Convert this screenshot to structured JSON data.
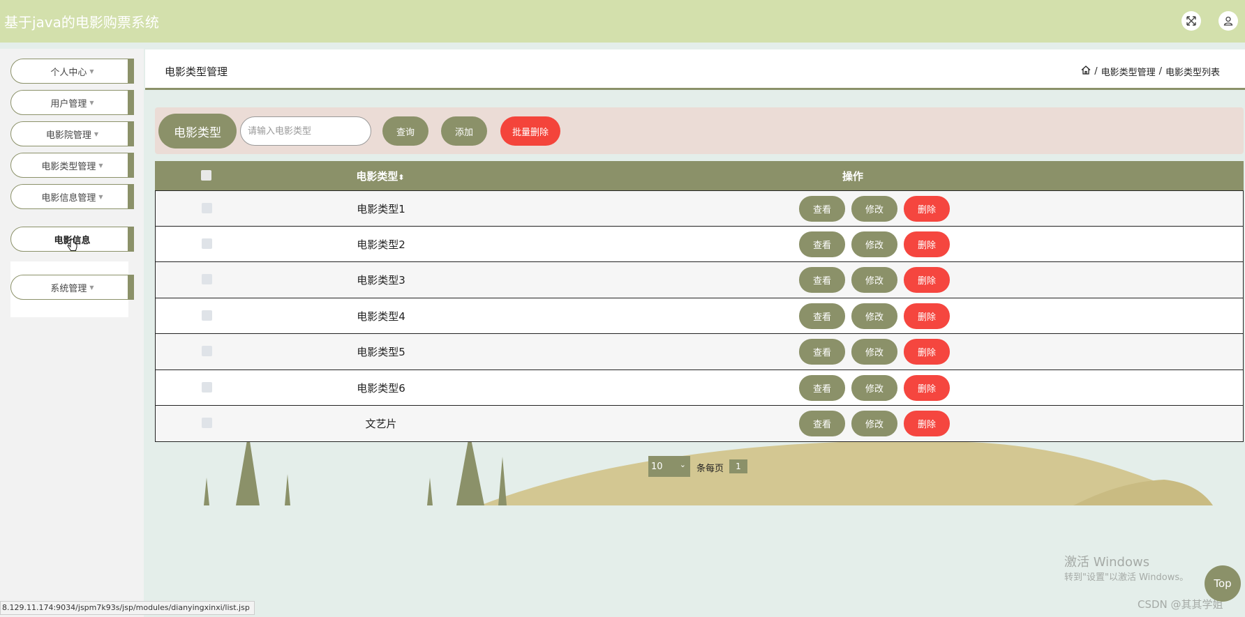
{
  "app": {
    "title": "基于java的电影购票系统"
  },
  "topbar": {
    "fullscreen_icon": "expand-arrows-icon",
    "user_icon": "user-icon"
  },
  "sidebar": {
    "items": [
      {
        "label": "个人中心",
        "caret": true
      },
      {
        "label": "用户管理",
        "caret": true
      },
      {
        "label": "电影院管理",
        "caret": true
      },
      {
        "label": "电影类型管理",
        "caret": true
      },
      {
        "label": "电影信息管理",
        "caret": true
      },
      {
        "label": "电影信息",
        "caret": false,
        "active": true
      },
      {
        "label": "系统管理",
        "caret": true
      }
    ]
  },
  "header": {
    "page_title": "电影类型管理",
    "breadcrumb": [
      "电影类型管理",
      "电影类型列表"
    ],
    "separator": "/"
  },
  "search": {
    "label": "电影类型",
    "placeholder": "请输入电影类型",
    "query_label": "查询",
    "add_label": "添加",
    "batch_delete_label": "批量删除"
  },
  "table": {
    "columns": [
      "电影类型",
      "操作"
    ],
    "sort_icon": "⬍",
    "rows": [
      {
        "name": "电影类型1"
      },
      {
        "name": "电影类型2"
      },
      {
        "name": "电影类型3"
      },
      {
        "name": "电影类型4"
      },
      {
        "name": "电影类型5"
      },
      {
        "name": "电影类型6"
      },
      {
        "name": "文艺片"
      }
    ],
    "actions": {
      "view": "查看",
      "edit": "修改",
      "delete": "删除"
    }
  },
  "pager": {
    "page_size": "10",
    "per_page_text": "条每页",
    "current_page": "1"
  },
  "footer": {
    "status_url": "8.129.11.174:9034/jspm7k93s/jsp/modules/dianyingxinxi/list.jsp",
    "watermark_line1": "激活 Windows",
    "watermark_line2": "转到\"设置\"以激活 Windows。",
    "csdn": "CSDN @其其学姐",
    "top_label": "Top"
  },
  "colors": {
    "topbar": "#d3e0ac",
    "accent": "#8b9169",
    "danger": "#f4443b",
    "search_bg": "#ebdcd6",
    "page_bg": "#e4eeea"
  }
}
